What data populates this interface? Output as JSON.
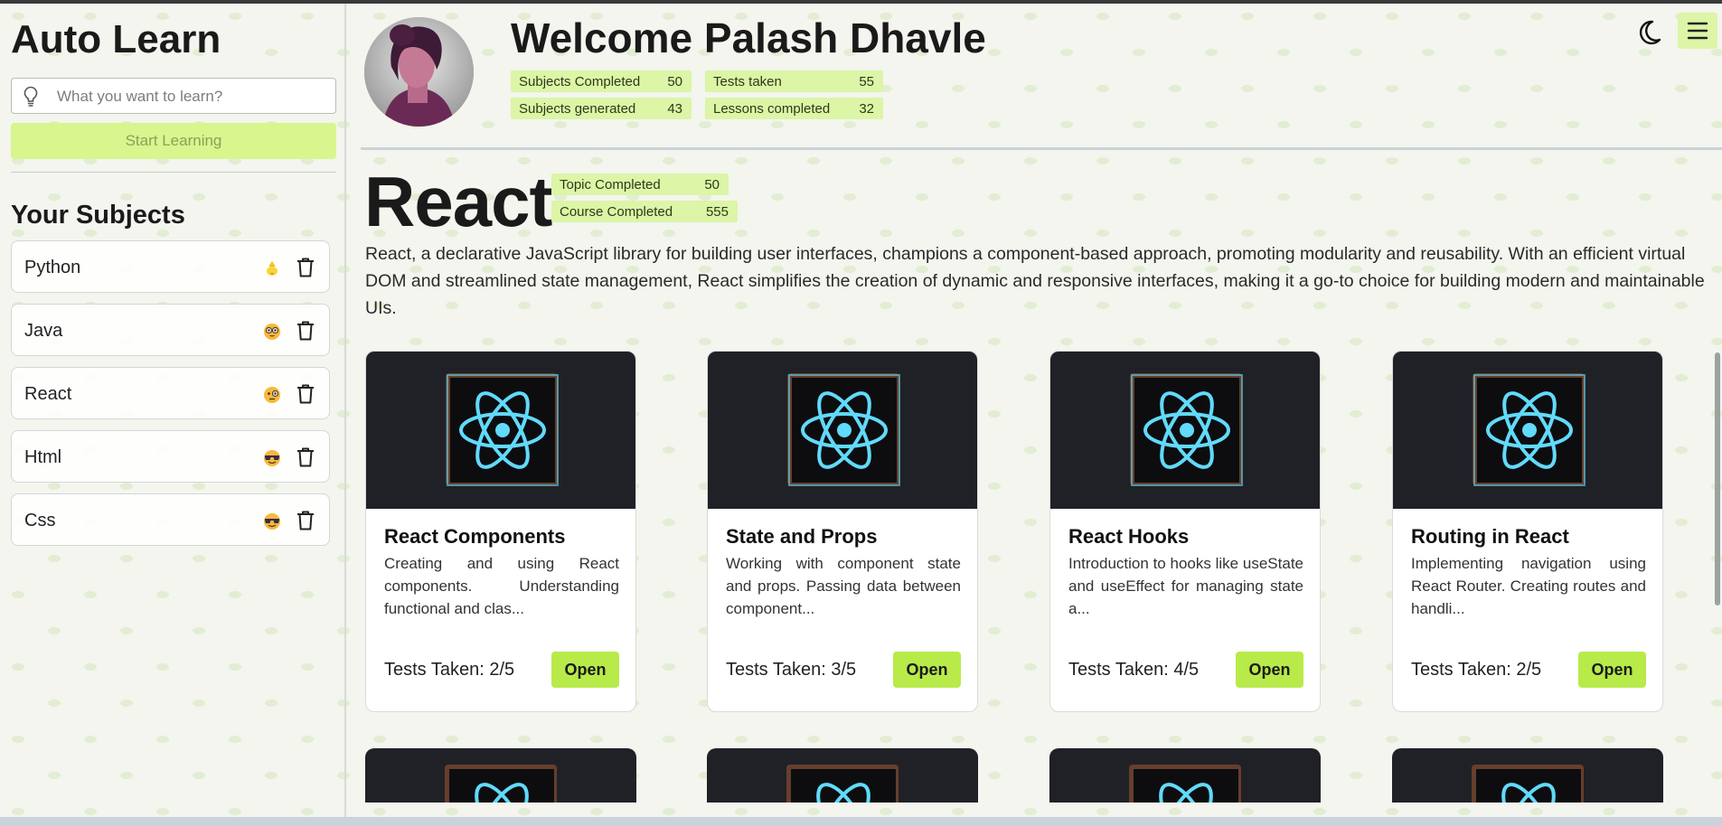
{
  "app": {
    "title": "Auto Learn"
  },
  "sidebar": {
    "search": {
      "placeholder": "What you want to learn?",
      "value": ""
    },
    "start_button": "Start Learning",
    "subjects_heading": "Your Subjects",
    "subjects": [
      {
        "name": "Python",
        "emoji": "chick-emoji-icon"
      },
      {
        "name": "Java",
        "emoji": "nerd-face-emoji-icon"
      },
      {
        "name": "React",
        "emoji": "monocle-face-emoji-icon"
      },
      {
        "name": "Html",
        "emoji": "sunglasses-face-emoji-icon"
      },
      {
        "name": "Css",
        "emoji": "sunglasses-face-emoji-icon"
      }
    ]
  },
  "header": {
    "welcome": "Welcome Palash Dhavle",
    "stats": [
      {
        "label": "Subjects Completed",
        "value": "50"
      },
      {
        "label": "Tests taken",
        "value": "55"
      },
      {
        "label": "Subjects generated",
        "value": "43"
      },
      {
        "label": "Lessons completed",
        "value": "32"
      }
    ]
  },
  "topic": {
    "title": "React",
    "stats": [
      {
        "label": "Topic Completed",
        "value": "50"
      },
      {
        "label": "Course Completed",
        "value": "555"
      }
    ],
    "description": "React, a declarative JavaScript library for building user interfaces, champions a component-based approach, promoting modularity and reusability. With an efficient virtual DOM and streamlined state management, React simplifies the creation of dynamic and responsive interfaces, making it a go-to choice for building modern and maintainable UIs."
  },
  "cards": [
    {
      "title": "React Components",
      "description": "Creating and using React components. Understanding functional and clas...",
      "tests": "Tests Taken: 2/5",
      "button": "Open"
    },
    {
      "title": "State and Props",
      "description": "Working with component state and props. Passing data between component...",
      "tests": "Tests Taken: 3/5",
      "button": "Open"
    },
    {
      "title": "React Hooks",
      "description": "Introduction to hooks like useState and useEffect for managing state a...",
      "tests": "Tests Taken: 4/5",
      "button": "Open"
    },
    {
      "title": "Routing in React",
      "description": "Implementing navigation using React Router. Creating routes and handli...",
      "tests": "Tests Taken: 2/5",
      "button": "Open"
    }
  ],
  "icons": {
    "search": "lightbulb-icon",
    "delete": "trash-icon",
    "theme": "moon-icon",
    "menu": "hamburger-menu-icon",
    "card_image": "react-logo-icon"
  },
  "colors": {
    "accent": "#b8ea4a",
    "accent_light": "#dcf5a6",
    "react_blue": "#61dafb",
    "card_dark": "#202126"
  }
}
